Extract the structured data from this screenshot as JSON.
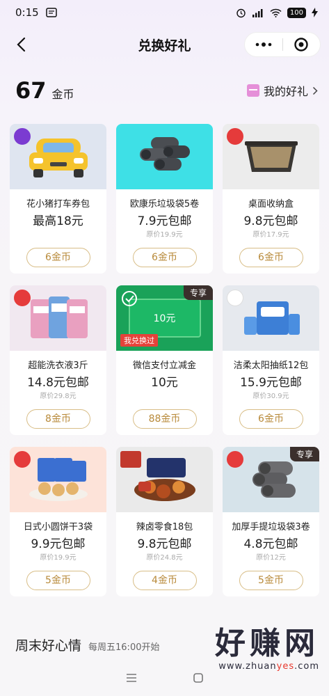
{
  "status": {
    "time": "0:15",
    "battery": "100"
  },
  "nav": {
    "title": "兑换好礼"
  },
  "coins": {
    "count": "67",
    "unit": "金币"
  },
  "my_gifts": {
    "label": "我的好礼"
  },
  "colors": {
    "accent": "#b88a3a",
    "tag_bg": "#3b2f2c",
    "redeemed_bg": "#e5423a"
  },
  "products": [
    {
      "name": "花小猪打车券包",
      "price": "最高18元",
      "original": "",
      "button": "6金币",
      "tag": "",
      "redeemed": ""
    },
    {
      "name": "欧康乐垃圾袋5卷",
      "price": "7.9元包邮",
      "original": "原价19.9元",
      "button": "6金币",
      "tag": "",
      "redeemed": ""
    },
    {
      "name": "桌面收纳盒",
      "price": "9.8元包邮",
      "original": "原价17.9元",
      "button": "6金币",
      "tag": "",
      "redeemed": ""
    },
    {
      "name": "超能洗衣液3斤",
      "price": "14.8元包邮",
      "original": "原价29.8元",
      "button": "8金币",
      "tag": "",
      "redeemed": ""
    },
    {
      "name": "微信支付立减金",
      "price": "10元",
      "original": "",
      "button": "88金币",
      "tag": "专享",
      "redeemed": "我兑换过",
      "voucher": "10元"
    },
    {
      "name": "洁柔太阳抽纸12包",
      "price": "15.9元包邮",
      "original": "原价30.9元",
      "button": "6金币",
      "tag": "",
      "redeemed": ""
    },
    {
      "name": "日式小圆饼干3袋",
      "price": "9.9元包邮",
      "original": "原价19.9元",
      "button": "5金币",
      "tag": "",
      "redeemed": ""
    },
    {
      "name": "辣卤零食18包",
      "price": "9.8元包邮",
      "original": "原价24.8元",
      "button": "4金币",
      "tag": "",
      "redeemed": ""
    },
    {
      "name": "加厚手提垃圾袋3卷",
      "price": "4.8元包邮",
      "original": "原价12元",
      "button": "5金币",
      "tag": "专享",
      "redeemed": ""
    }
  ],
  "weekend": {
    "title": "周末好心情",
    "subtitle": "每周五16:00开始"
  },
  "watermark": {
    "big": "好赚网",
    "small_prefix": "www.zhuan",
    "small_accent": "yes",
    "small_suffix": ".com"
  }
}
